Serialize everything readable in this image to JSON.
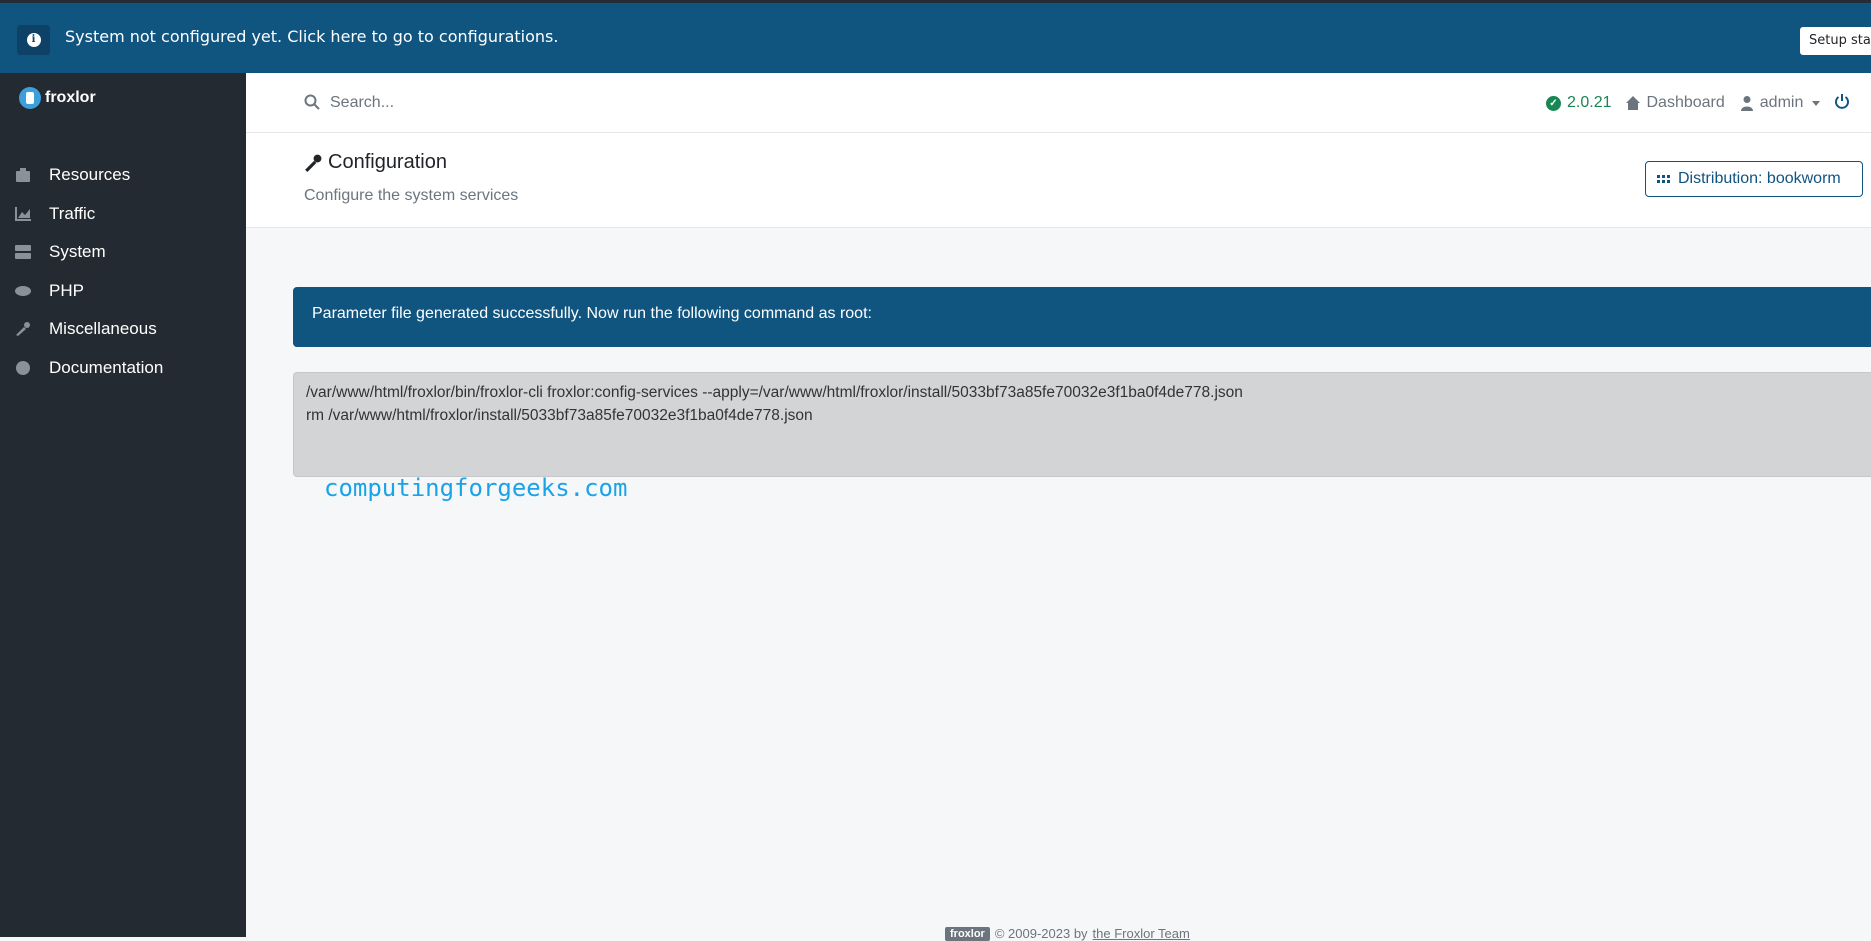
{
  "notice": {
    "message": "System not configured yet. Click here to go to configurations.",
    "setup_button": "Setup started"
  },
  "brand": {
    "name": "froxlor"
  },
  "sidebar": {
    "items": [
      {
        "label": "Resources",
        "icon": "box-icon"
      },
      {
        "label": "Traffic",
        "icon": "chart-icon"
      },
      {
        "label": "System",
        "icon": "server-icon"
      },
      {
        "label": "PHP",
        "icon": "php-icon"
      },
      {
        "label": "Miscellaneous",
        "icon": "wrench-icon"
      },
      {
        "label": "Documentation",
        "icon": "info-icon"
      }
    ]
  },
  "header": {
    "search_placeholder": "Search...",
    "version": "2.0.21",
    "dashboard": "Dashboard",
    "user": "admin"
  },
  "page": {
    "title": "Configuration",
    "subtitle": "Configure the system services",
    "distribution_button": "Distribution: bookworm"
  },
  "alert": {
    "text": "Parameter file generated successfully. Now run the following command as root:"
  },
  "command": {
    "text": "/var/www/html/froxlor/bin/froxlor-cli froxlor:config-services --apply=/var/www/html/froxlor/install/5033bf73a85fe70032e3f1ba0f4de778.json\nrm /var/www/html/froxlor/install/5033bf73a85fe70032e3f1ba0f4de778.json"
  },
  "watermark": "computingforgeeks.com",
  "footer": {
    "badge": "froxlor",
    "copyright": "© 2009-2023 by",
    "team": "the Froxlor Team"
  },
  "colors": {
    "primary": "#105480",
    "sidebar": "#232a31",
    "success": "#198754"
  }
}
